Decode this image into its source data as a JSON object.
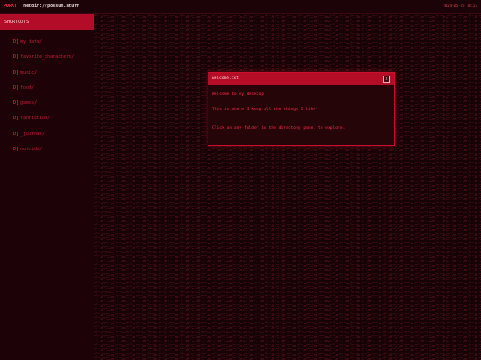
{
  "topbar": {
    "brand": "PORKT",
    "separator": "|",
    "path": "netdir://possum.stuff",
    "datetime": "2024-05-15 14:23"
  },
  "sidebar": {
    "header": "SHORTCUTS",
    "items": [
      {
        "prefix": "[D]",
        "label": "my_data/"
      },
      {
        "prefix": "[D]",
        "label": "favorite_characters/"
      },
      {
        "prefix": "[D]",
        "label": "music/"
      },
      {
        "prefix": "[D]",
        "label": "food/"
      },
      {
        "prefix": "[D]",
        "label": "games/"
      },
      {
        "prefix": "[D]",
        "label": "fanfiction/"
      },
      {
        "prefix": "[D]",
        "label": "_journal/"
      },
      {
        "prefix": "[D]",
        "label": "outside/"
      }
    ]
  },
  "dialog": {
    "title": "welcome.txt",
    "close_label": "x",
    "lines": [
      "Welcome to my desktop!",
      "This is where I keep all the things I like*",
      "Click on any folder in the directory panel to explore."
    ]
  },
  "colors": {
    "background": "#140306",
    "accent": "#b30c28",
    "text_red": "#ff2a45",
    "dim_red": "#c51c33"
  },
  "icons": {
    "folder": "folder-icon",
    "close": "close-icon"
  }
}
